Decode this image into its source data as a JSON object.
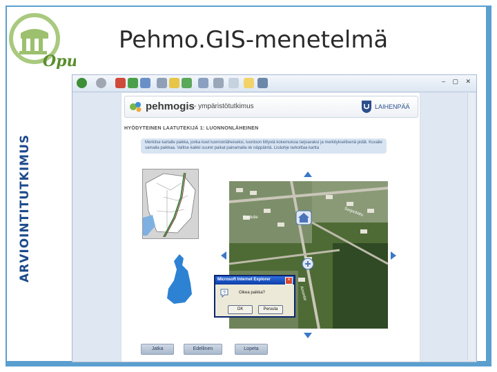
{
  "slide": {
    "title": "Pehmo.GIS-menetelmä",
    "vertical_text": "ARVIOINTITUTKIMUS",
    "logo_text": "Opus"
  },
  "browser": {
    "window_controls": "– ▢ ✕"
  },
  "app": {
    "brand_name": "pehmogis",
    "brand_sub": "- ympäristötutkimus",
    "city_name": "LAIHENPÄÄ",
    "section_title": "HYÖDYTEINEN LAATUTEKIJÄ 1: LUONNONLÄHEINEN",
    "instructions": "Merkitse kartalle paikka, jonka koet luonnonläheiseksi, luontoon liittyviä kokemuksia tarjoavaksi ja merkityksellisenä pidät. Kuvaile samalla paikkaa. Valitse kaikki suuret paikat painamalla ok näppäintä. Lisäohje tarkoittaa kartta"
  },
  "map": {
    "labels": [
      "Koulutie",
      "Sorjonkatu",
      "Ainontie"
    ],
    "home_icon": "home-icon",
    "zoom_icon": "zoom-in-icon"
  },
  "dialog": {
    "title": "Microsoft Internet Explorer",
    "message": "Oikea paikka?",
    "ok_label": "OK",
    "cancel_label": "Peruuta"
  },
  "nav": {
    "next_label": "Jatka",
    "prev_label": "Edellinen",
    "stop_label": "Lopeta"
  },
  "colors": {
    "frame": "#5a9fcf",
    "title_text": "#1e4b8c",
    "arrow": "#3a78c9"
  }
}
